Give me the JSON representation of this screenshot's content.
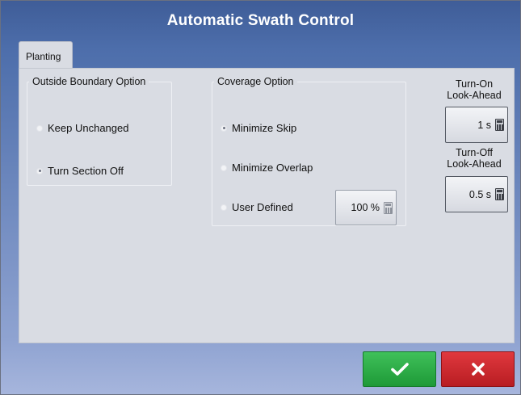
{
  "window": {
    "title": "Automatic Swath Control"
  },
  "tabs": [
    {
      "label": "Planting",
      "active": true
    }
  ],
  "outside_boundary": {
    "legend": "Outside Boundary Option",
    "options": [
      {
        "label": "Keep Unchanged",
        "selected": false
      },
      {
        "label": "Turn Section Off",
        "selected": true
      }
    ]
  },
  "coverage": {
    "legend": "Coverage Option",
    "options": [
      {
        "label": "Minimize Skip",
        "selected": true
      },
      {
        "label": "Minimize Overlap",
        "selected": false
      },
      {
        "label": "User Defined",
        "selected": false
      }
    ],
    "user_defined_value": "100 %"
  },
  "turn_on": {
    "label_line1": "Turn-On",
    "label_line2": "Look-Ahead",
    "value": "1 s"
  },
  "turn_off": {
    "label_line1": "Turn-Off",
    "label_line2": "Look-Ahead",
    "value": "0.5 s"
  },
  "actions": {
    "confirm_icon": "checkmark-icon",
    "cancel_icon": "x-icon"
  },
  "colors": {
    "title_bar": "#3f5d98",
    "panel": "#d9dce3",
    "confirm": "#2aa845",
    "cancel": "#cc2a2f"
  }
}
